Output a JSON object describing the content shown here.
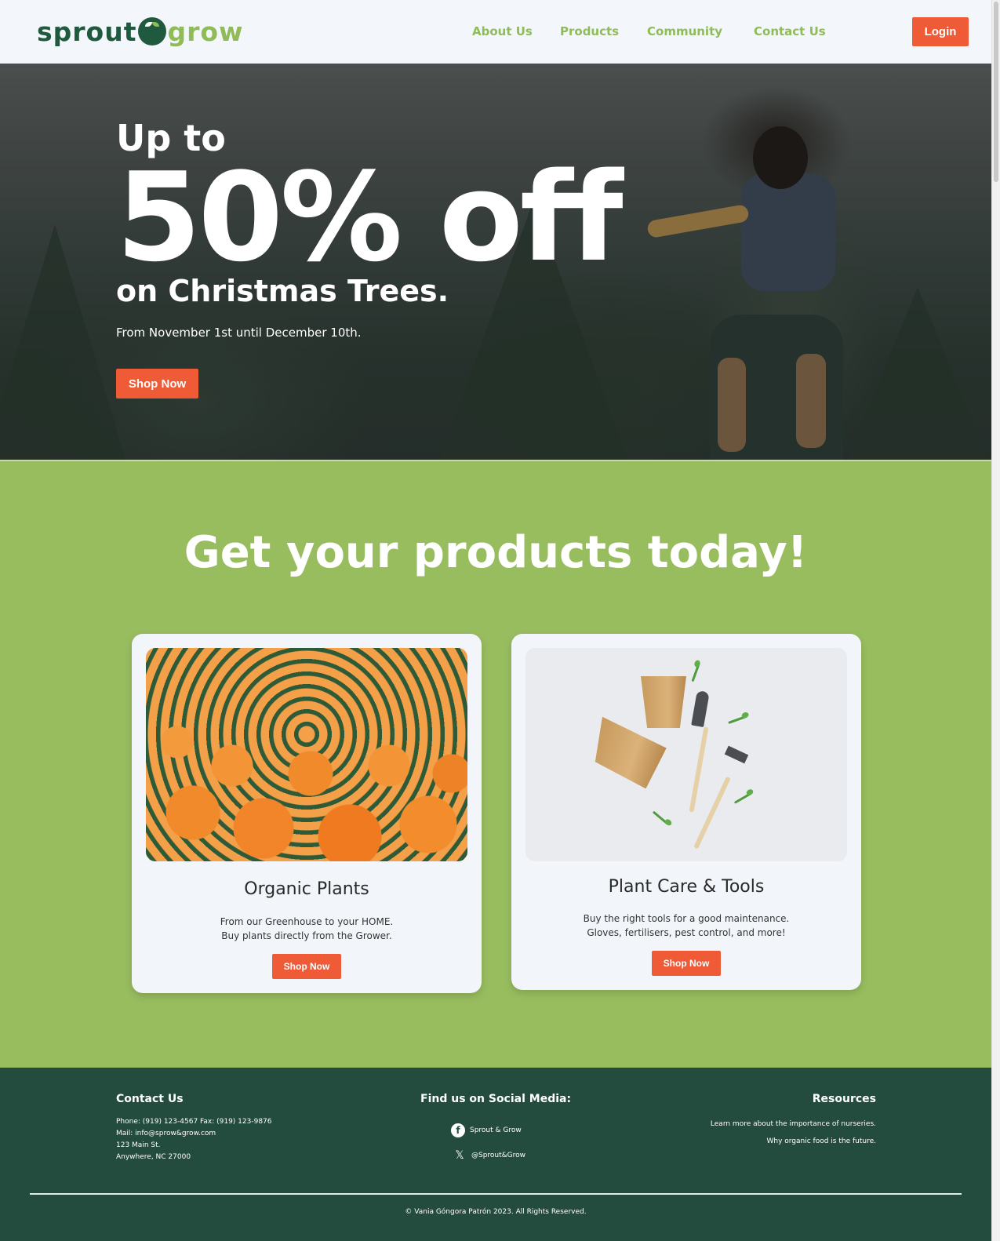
{
  "brand": {
    "part1": "sprout",
    "part2": "grow"
  },
  "nav": {
    "links": [
      "About Us",
      "Products",
      "Community",
      "Contact Us"
    ],
    "login": "Login"
  },
  "hero": {
    "line1": "Up to",
    "big": "50% off",
    "line3": "on Christmas Trees.",
    "dates": "From November 1st until December 10th.",
    "cta": "Shop Now"
  },
  "products": {
    "title": "Get your products today!",
    "cards": [
      {
        "image_icon": "marigold-greenhouse-image",
        "title": "Organic Plants",
        "desc1": "From our Greenhouse to your HOME.",
        "desc2": "Buy plants directly from the Grower.",
        "cta": "Shop Now"
      },
      {
        "image_icon": "garden-tools-image",
        "title": "Plant Care & Tools",
        "desc1": "Buy the right tools for a good maintenance.",
        "desc2": "Gloves, fertilisers, pest control, and more!",
        "cta": "Shop Now"
      }
    ]
  },
  "footer": {
    "contact": {
      "title": "Contact Us",
      "phone": "Phone: (919) 123-4567 Fax: (919) 123-9876",
      "mail": "Mail: info@sprow&grow.com",
      "street": "123 Main St.",
      "city": "Anywhere, NC 27000"
    },
    "social": {
      "title": "Find us on Social Media:",
      "facebook": "Sprout & Grow",
      "x": "@Sprout&Grow"
    },
    "resources": {
      "title": "Resources",
      "link1": "Learn more about the importance of nurseries.",
      "link2": "Why organic food is the future."
    },
    "copyright": "© Vania Góngora Patrón 2023. All Rights Reserved."
  },
  "colors": {
    "accent": "#ef5a37",
    "brand_dark": "#1f5a3e",
    "brand_light": "#8fbc57",
    "products_bg": "#98bd5f",
    "footer_bg": "#234c3e"
  }
}
